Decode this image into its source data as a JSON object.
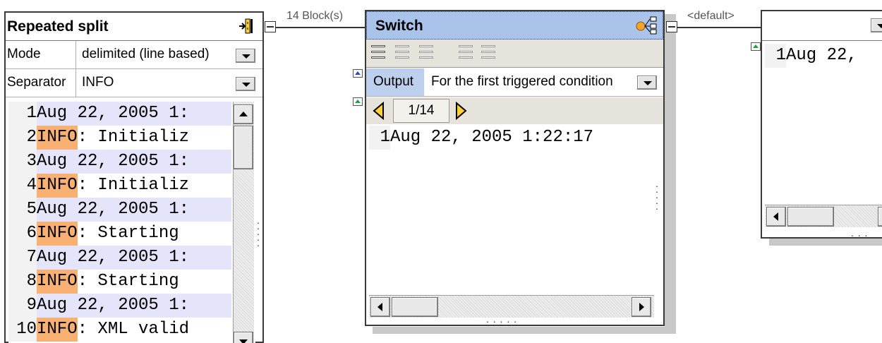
{
  "repeated_split": {
    "title": "Repeated split",
    "mode_label": "Mode",
    "mode_value": "delimited (line based)",
    "separator_label": "Separator",
    "separator_value": "INFO",
    "lines": [
      {
        "n": "1",
        "hl": "",
        "rest": "Aug 22, 2005 1:"
      },
      {
        "n": "2",
        "hl": "INFO",
        "rest": ": Initializ"
      },
      {
        "n": "3",
        "hl": "",
        "rest": "Aug 22, 2005 1:"
      },
      {
        "n": "4",
        "hl": "INFO",
        "rest": ": Initializ"
      },
      {
        "n": "5",
        "hl": "",
        "rest": "Aug 22, 2005 1:"
      },
      {
        "n": "6",
        "hl": "INFO",
        "rest": ": Starting "
      },
      {
        "n": "7",
        "hl": "",
        "rest": "Aug 22, 2005 1:"
      },
      {
        "n": "8",
        "hl": "INFO",
        "rest": ": Starting "
      },
      {
        "n": "9",
        "hl": "",
        "rest": "Aug 22, 2005 1:"
      },
      {
        "n": "10",
        "hl": "INFO",
        "rest": ": XML valid"
      }
    ]
  },
  "connection_1": {
    "label": "14 Block(s)"
  },
  "switch": {
    "title": "Switch",
    "output_label": "Output",
    "output_value": "For the first triggered condition",
    "page_indicator": "1/14",
    "lines": [
      {
        "n": "1",
        "text": "Aug 22, 2005 1:22:17"
      }
    ]
  },
  "connection_2": {
    "label": "<default>"
  },
  "right_panel": {
    "lines": [
      {
        "n": "1",
        "text": "Aug 22,"
      }
    ]
  },
  "colors": {
    "switch_title_bg": "#a9c3ea",
    "highlight": "#f9b173",
    "row_tint": "#e4e4fa"
  },
  "icons": {
    "split": "split-icon",
    "switch": "switch-icon"
  }
}
